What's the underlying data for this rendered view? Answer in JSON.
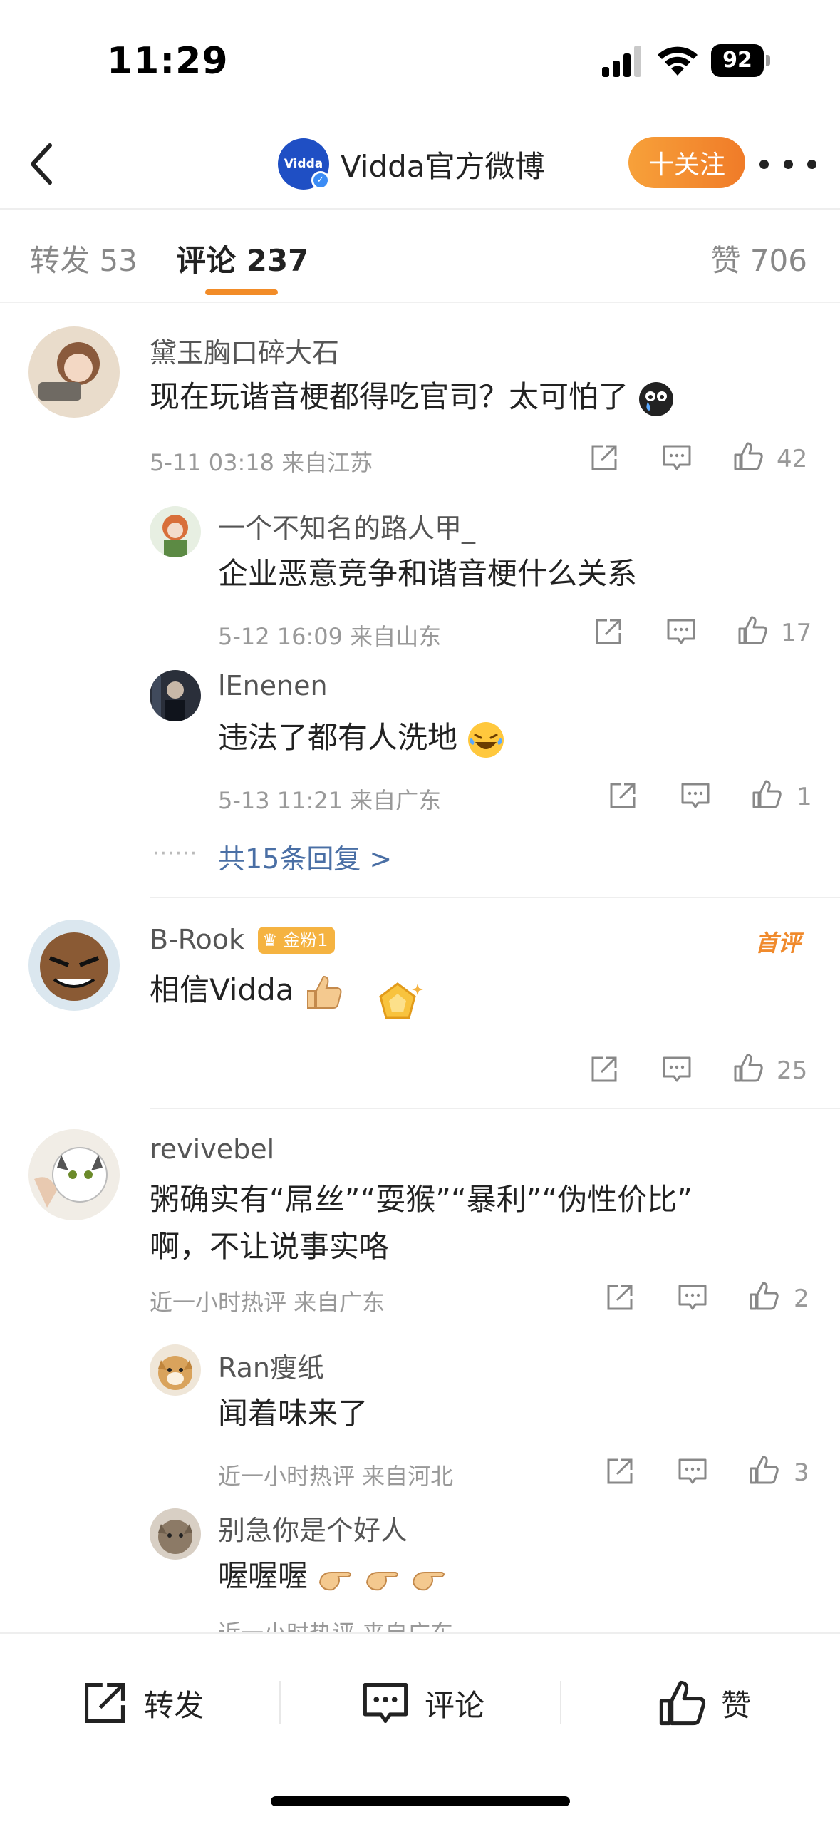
{
  "status_bar": {
    "time": "11:29",
    "battery": "92"
  },
  "header": {
    "avatar_text": "Vidda",
    "title": "Vidda官方微博",
    "follow_label": "十关注"
  },
  "tabs": {
    "repost": "转发 53",
    "comments": "评论 237",
    "likes": "赞 706"
  },
  "comments": [
    {
      "user": "黛玉胸口碎大石",
      "text": "现在玩谐音梗都得吃官司？太可怕了",
      "meta": "5-11 03:18  来自江苏",
      "likes": "42",
      "replies": [
        {
          "user": "一个不知名的路人甲_",
          "text": "企业恶意竞争和谐音梗什么关系",
          "meta": "5-12 16:09  来自山东",
          "likes": "17"
        },
        {
          "user": "lEnenen",
          "text": "违法了都有人洗地",
          "meta": "5-13 11:21  来自广东",
          "likes": "1"
        }
      ],
      "more_replies": "共15条回复 >"
    },
    {
      "user": "B-Rook",
      "fan_badge": "金粉1",
      "first_badge": "首评",
      "text": "相信Vidda",
      "likes": "25"
    },
    {
      "user": "revivebel",
      "text_line1": "粥确实有“屌丝”“耍猴”“暴利”“伪性价比”",
      "text_line2": "啊，不让说事实咯",
      "meta": "近一小时热评  来自广东",
      "likes": "2",
      "replies": [
        {
          "user": "Ran瘦纸",
          "text": "闻着味来了",
          "meta": "近一小时热评  来自河北",
          "likes": "3"
        },
        {
          "user": "别急你是个好人",
          "text": "喔喔喔",
          "meta": "近一小时热评  来自广东"
        }
      ]
    }
  ],
  "bottom_bar": {
    "repost": "转发",
    "comment": "评论",
    "like": "赞"
  },
  "colors": {
    "accent_orange": "#f28c28",
    "link_blue": "#4a6fa5"
  }
}
